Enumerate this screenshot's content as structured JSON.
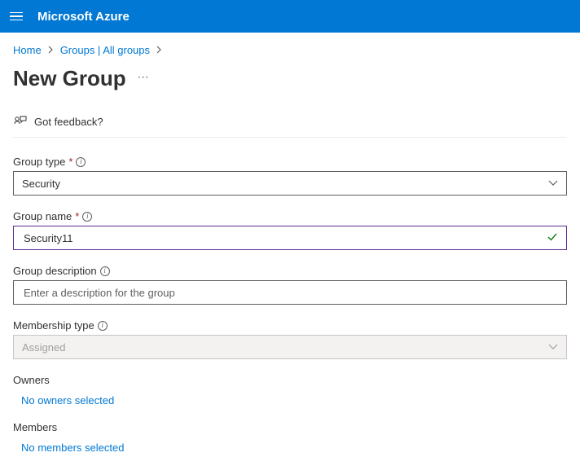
{
  "topbar": {
    "brand": "Microsoft Azure"
  },
  "breadcrumb": {
    "items": [
      "Home",
      "Groups | All groups"
    ]
  },
  "page": {
    "title": "New Group",
    "feedback_label": "Got feedback?"
  },
  "form": {
    "group_type": {
      "label": "Group type",
      "value": "Security",
      "required": true
    },
    "group_name": {
      "label": "Group name",
      "value": "Security11",
      "required": true,
      "valid": true
    },
    "group_description": {
      "label": "Group description",
      "placeholder": "Enter a description for the group",
      "value": ""
    },
    "membership_type": {
      "label": "Membership type",
      "value": "Assigned",
      "disabled": true
    },
    "owners": {
      "heading": "Owners",
      "link": "No owners selected"
    },
    "members": {
      "heading": "Members",
      "link": "No members selected"
    }
  }
}
